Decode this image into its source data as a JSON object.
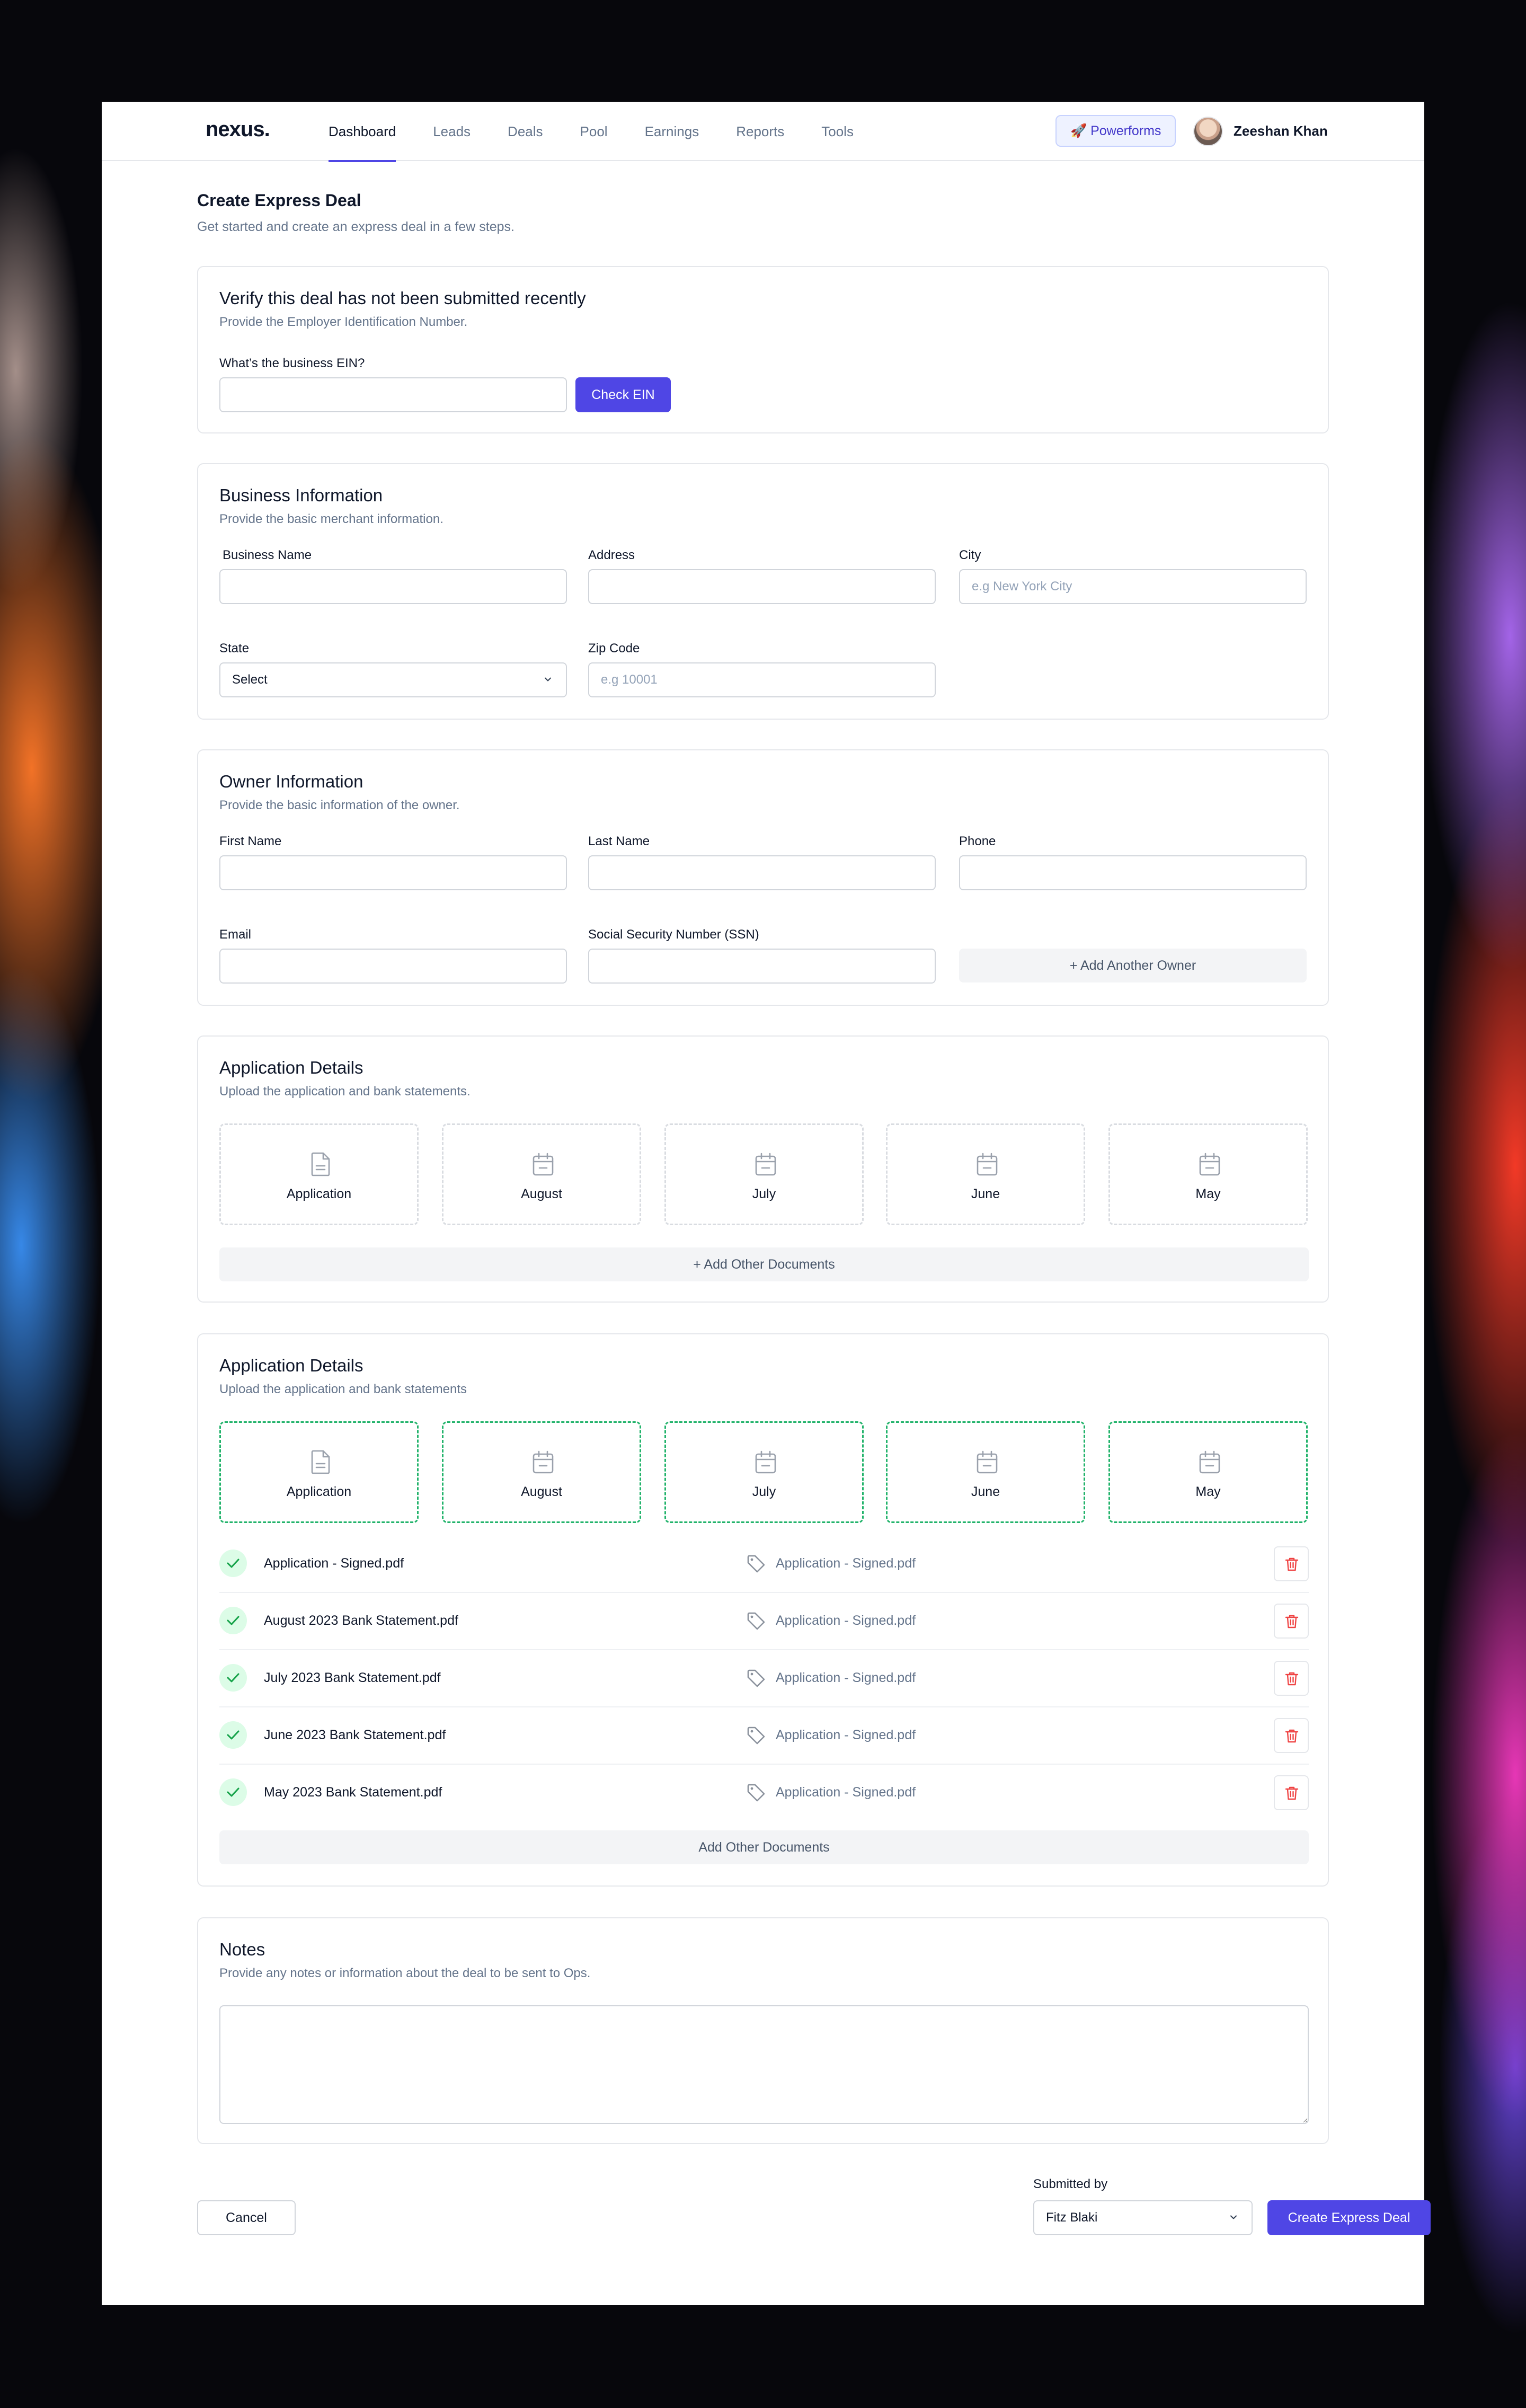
{
  "nav": {
    "logo": "nexus.",
    "items": [
      "Dashboard",
      "Leads",
      "Deals",
      "Pool",
      "Earnings",
      "Reports",
      "Tools"
    ],
    "active": "Dashboard",
    "powerforms": "🚀 Powerforms",
    "user_name": "Zeeshan Khan"
  },
  "page": {
    "title": "Create Express Deal",
    "subtitle": "Get started and create an express deal in a few steps."
  },
  "verify": {
    "title": "Verify this deal has not been submitted recently",
    "subtitle": "Provide the Employer Identification Number.",
    "ein_label": "What’s the business EIN?",
    "ein_value": "",
    "button": "Check EIN"
  },
  "business": {
    "title": "Business Information",
    "subtitle": "Provide the basic merchant information.",
    "name_label": "Business Name",
    "address_label": "Address",
    "city_label": "City",
    "city_placeholder": "e.g New York City",
    "state_label": "State",
    "state_value": "Select",
    "zip_label": "Zip Code",
    "zip_placeholder": "e.g 10001"
  },
  "owner": {
    "title": "Owner Information",
    "subtitle": "Provide the basic information of the owner.",
    "first_label": "First Name",
    "last_label": "Last Name",
    "phone_label": "Phone",
    "email_label": "Email",
    "ssn_label": "Social Security Number (SSN)",
    "add_owner": "+ Add Another Owner"
  },
  "application_empty": {
    "title": "Application Details",
    "subtitle": "Upload the application and bank statements.",
    "tiles": [
      "Application",
      "August",
      "July",
      "June",
      "May"
    ],
    "add_docs": "+ Add Other Documents"
  },
  "application_uploaded": {
    "title": "Application Details",
    "subtitle": "Upload the application and bank statements",
    "tiles": [
      "Application",
      "August",
      "July",
      "June",
      "May"
    ],
    "files": [
      {
        "name": "Application - Signed.pdf",
        "tag": "Application - Signed.pdf"
      },
      {
        "name": "August 2023 Bank Statement.pdf",
        "tag": "Application - Signed.pdf"
      },
      {
        "name": "July 2023 Bank Statement.pdf",
        "tag": "Application - Signed.pdf"
      },
      {
        "name": "June 2023 Bank Statement.pdf",
        "tag": "Application - Signed.pdf"
      },
      {
        "name": "May 2023 Bank Statement.pdf",
        "tag": "Application - Signed.pdf"
      }
    ],
    "add_docs": "Add Other Documents"
  },
  "notes": {
    "title": "Notes",
    "subtitle": "Provide any notes or information about the deal to be sent to Ops.",
    "value": ""
  },
  "footer": {
    "cancel": "Cancel",
    "submitted_by_label": "Submitted by",
    "submitted_by_value": "Fitz Blaki",
    "create": "Create Express Deal"
  },
  "colors": {
    "accent": "#4f46e5",
    "success": "#22b36b",
    "danger": "#ef4444"
  }
}
